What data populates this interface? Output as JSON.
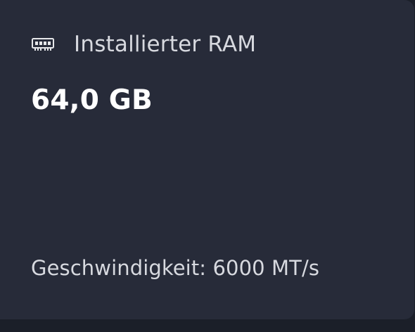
{
  "card": {
    "icon": "ram-module-icon",
    "title": "Installierter RAM",
    "value": "64,0 GB",
    "speed_text": "Geschwindigkeit: 6000 MT/s"
  },
  "colors": {
    "card_background": "#272b39",
    "page_background": "#1b1f29",
    "primary_text": "#ffffff",
    "secondary_text": "#d7d9df"
  }
}
